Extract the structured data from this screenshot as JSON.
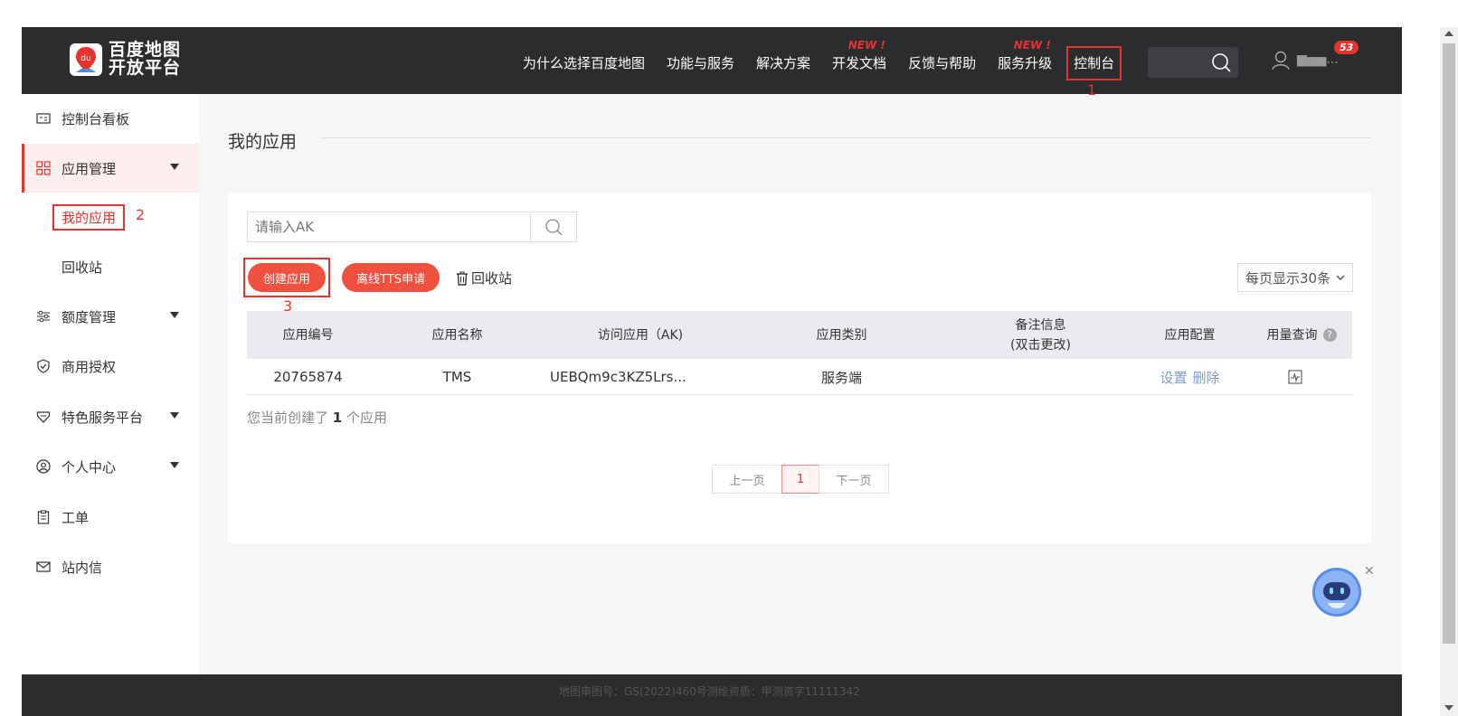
{
  "header": {
    "logo_line1": "百度地图",
    "logo_line2": "开放平台",
    "logo_mark": "du",
    "nav": [
      {
        "label": "为什么选择百度地图",
        "new": ""
      },
      {
        "label": "功能与服务",
        "new": ""
      },
      {
        "label": "解决方案",
        "new": ""
      },
      {
        "label": "开发文档",
        "new": "NEW !"
      },
      {
        "label": "反馈与帮助",
        "new": ""
      },
      {
        "label": "服务升级",
        "new": "NEW !"
      },
      {
        "label": "控制台",
        "new": ""
      }
    ],
    "notification_count": "53",
    "user_name": "▆▅▅...",
    "annotation_1": "1"
  },
  "sidebar": {
    "items": [
      {
        "label": "控制台看板",
        "icon": "dashboard-icon"
      },
      {
        "label": "应用管理",
        "icon": "grid-icon"
      },
      {
        "label": "额度管理",
        "icon": "sliders-icon"
      },
      {
        "label": "商用授权",
        "icon": "shield-icon"
      },
      {
        "label": "特色服务平台",
        "icon": "tag-icon"
      },
      {
        "label": "个人中心",
        "icon": "user-circle-icon"
      },
      {
        "label": "工单",
        "icon": "clipboard-icon"
      },
      {
        "label": "站内信",
        "icon": "mail-icon"
      }
    ],
    "sub_items": [
      "我的应用",
      "回收站"
    ],
    "annotation_2": "2"
  },
  "main": {
    "title": "我的应用",
    "search_placeholder": "请输入AK",
    "create_button": "创建应用",
    "tts_button": "离线TTS申请",
    "recycle_link": "回收站",
    "annotation_3": "3",
    "page_size": "每页显示30条",
    "columns": [
      "应用编号",
      "应用名称",
      "访问应用（AK)",
      "应用类别",
      "备注信息",
      "(双击更改)",
      "应用配置",
      "用量查询"
    ],
    "rows": [
      {
        "id": "20765874",
        "name": "TMS",
        "ak": "UEBQm9c3KZ5Lrs...",
        "category": "服务端",
        "note": "",
        "settings": "设置",
        "delete": "删除"
      }
    ],
    "count_prefix": "您当前创建了",
    "count": "1",
    "count_suffix": "个应用",
    "pager": {
      "prev": "上一页",
      "current": "1",
      "next": "下一页"
    }
  },
  "footer": {
    "text": "地图审图号：GS(2022)460号测绘资质：甲测资字11111342"
  },
  "colors": {
    "accent": "#e8322c",
    "header_bg": "#2b2c2e",
    "button_red": "#f0503e",
    "link": "#7a9ccc"
  }
}
